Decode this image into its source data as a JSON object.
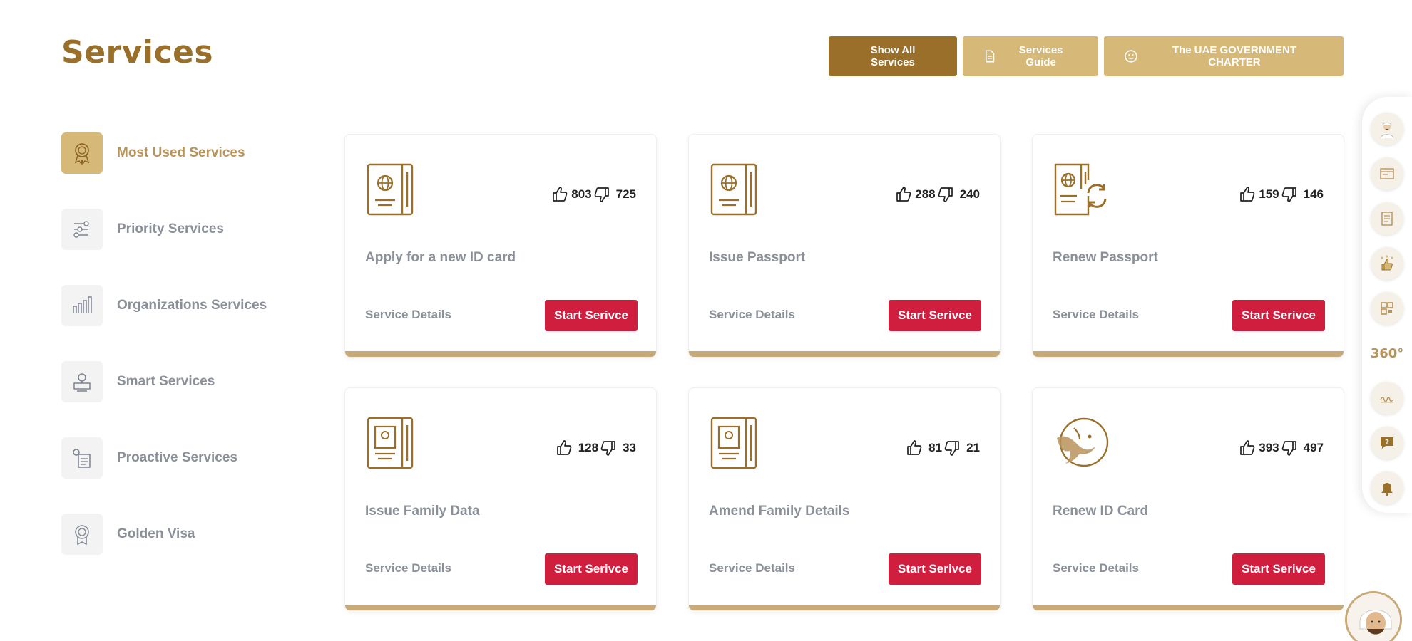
{
  "page": {
    "title": "Services"
  },
  "header_buttons": {
    "show_all": "Show All Services",
    "guide": "Services Guide",
    "charter": "The UAE GOVERNMENT CHARTER"
  },
  "sidebar": {
    "items": [
      {
        "label": "Most Used Services",
        "icon": "award-icon",
        "active": true
      },
      {
        "label": "Priority Services",
        "icon": "priority-icon"
      },
      {
        "label": "Organizations Services",
        "icon": "organizations-icon"
      },
      {
        "label": "Smart Services",
        "icon": "smart-icon"
      },
      {
        "label": "Proactive Services",
        "icon": "proactive-icon"
      },
      {
        "label": "Golden Visa",
        "icon": "golden-visa-icon"
      }
    ]
  },
  "cards": [
    {
      "title": "Apply for a new ID card",
      "likes": "803",
      "dislikes": "725",
      "icon": "passport-icon",
      "details": "Service Details",
      "start": "Start Serivce"
    },
    {
      "title": "Issue Passport",
      "likes": "288",
      "dislikes": "240",
      "icon": "passport-icon",
      "details": "Service Details",
      "start": "Start Serivce"
    },
    {
      "title": "Renew Passport",
      "likes": "159",
      "dislikes": "146",
      "icon": "passport-renew-icon",
      "details": "Service Details",
      "start": "Start Serivce"
    },
    {
      "title": "Issue Family Data",
      "likes": "128",
      "dislikes": "33",
      "icon": "family-book-icon",
      "details": "Service Details",
      "start": "Start Serivce"
    },
    {
      "title": "Amend Family Details",
      "likes": "81",
      "dislikes": "21",
      "icon": "family-book-icon",
      "details": "Service Details",
      "start": "Start Serivce"
    },
    {
      "title": "Renew ID Card",
      "likes": "393",
      "dislikes": "497",
      "icon": "falcon-emblem-icon",
      "details": "Service Details",
      "start": "Start Serivce"
    }
  ],
  "floating_bar": {
    "items": [
      "assistant-icon",
      "screen-icon",
      "checklist-icon",
      "rating-icon",
      "qr-icon",
      "view-360-icon",
      "signature-icon",
      "help-icon",
      "bell-icon"
    ],
    "label_360": "360°"
  },
  "colors": {
    "gold_dark": "#9a6f2a",
    "gold_light": "#d6b978",
    "card_bar": "#c8a978",
    "start_button": "#d01e3f",
    "muted_text": "#8a8f98"
  }
}
